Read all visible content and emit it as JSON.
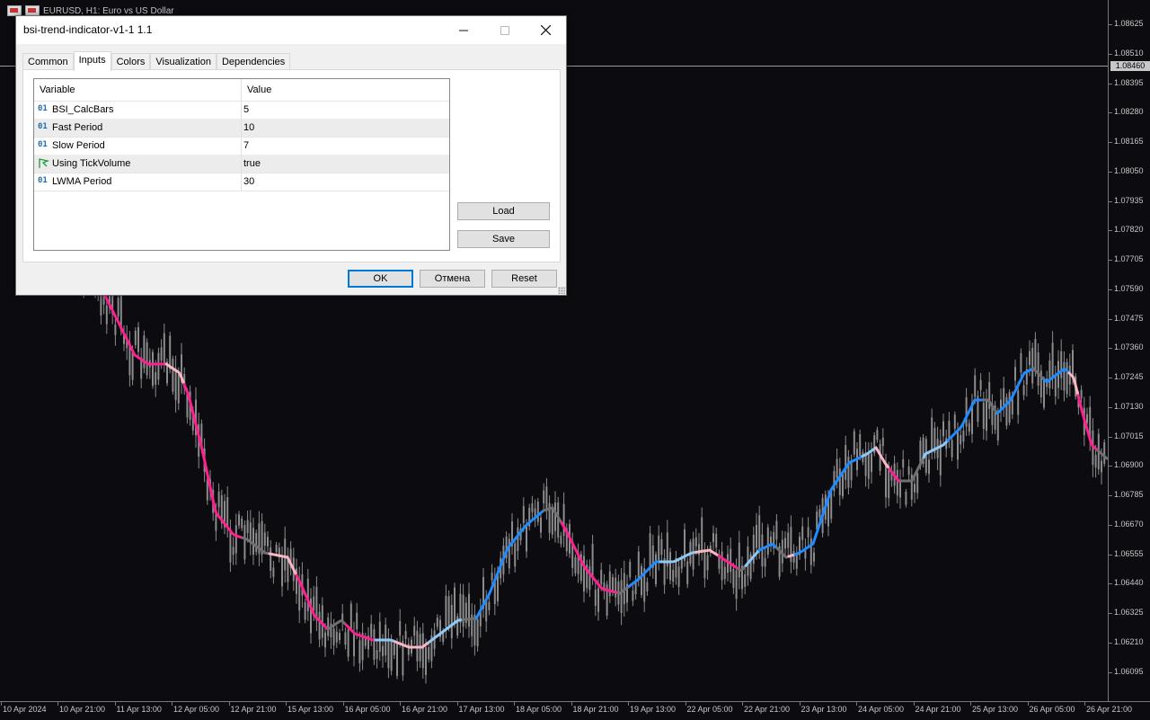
{
  "chart": {
    "symbol_label": "EURUSD, H1:  Euro vs US Dollar",
    "current_price": "1.08460",
    "price_levels": [
      "1.08625",
      "1.08510",
      "1.08395",
      "1.08280",
      "1.08165",
      "1.08050",
      "1.07935",
      "1.07820",
      "1.07705",
      "1.07590",
      "1.07475",
      "1.07360",
      "1.07245",
      "1.07130",
      "1.07015",
      "1.06900",
      "1.06785",
      "1.06670",
      "1.06555",
      "1.06440",
      "1.06325",
      "1.06210",
      "1.06095"
    ],
    "time_labels": [
      "10 Apr 2024",
      "10 Apr 21:00",
      "11 Apr 13:00",
      "12 Apr 05:00",
      "12 Apr 21:00",
      "15 Apr 13:00",
      "16 Apr 05:00",
      "16 Apr 21:00",
      "17 Apr 13:00",
      "18 Apr 05:00",
      "18 Apr 21:00",
      "19 Apr 13:00",
      "22 Apr 05:00",
      "22 Apr 21:00",
      "23 Apr 13:00",
      "24 Apr 05:00",
      "24 Apr 21:00",
      "25 Apr 13:00",
      "26 Apr 05:00",
      "26 Apr 21:00"
    ],
    "colors": {
      "background": "#0b0b10",
      "candles": "#8c8c8c",
      "strong_down": "#ff1f8e",
      "weak_down": "#f7b8c4",
      "neutral": "#707070",
      "weak_up": "#8ec8f5",
      "strong_up": "#1e8cff"
    }
  },
  "dialog": {
    "title": "bsi-trend-indicator-v1-1 1.1",
    "tabs": [
      "Common",
      "Inputs",
      "Colors",
      "Visualization",
      "Dependencies"
    ],
    "active_tab": "Inputs",
    "grid": {
      "headers": {
        "variable": "Variable",
        "value": "Value"
      },
      "rows": [
        {
          "icon": "int-icon",
          "glyph": "01",
          "name": "BSI_CalcBars",
          "value": "5"
        },
        {
          "icon": "int-icon",
          "glyph": "01",
          "name": "Fast Period",
          "value": "10"
        },
        {
          "icon": "int-icon",
          "glyph": "01",
          "name": "Slow Period",
          "value": "7"
        },
        {
          "icon": "bool-icon",
          "glyph": "",
          "name": "Using TickVolume",
          "value": "true"
        },
        {
          "icon": "int-icon",
          "glyph": "01",
          "name": "LWMA Period",
          "value": "30"
        }
      ]
    },
    "buttons": {
      "load": "Load",
      "save": "Save",
      "ok": "OK",
      "cancel": "Отмена",
      "reset": "Reset"
    }
  }
}
